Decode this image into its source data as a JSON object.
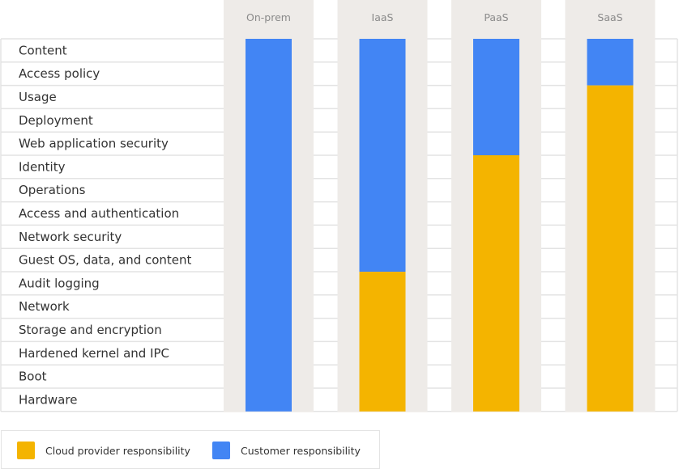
{
  "chart_data": {
    "type": "table",
    "title": "",
    "subtitle": "",
    "description": "Shared responsibility matrix: each column is a stacked bar over 16 ordered layers (top to bottom); customer layers on top, cloud provider layers below.",
    "rows": [
      "Content",
      "Access policy",
      "Usage",
      "Deployment",
      "Web application security",
      "Identity",
      "Operations",
      "Access and authentication",
      "Network security",
      "Guest OS, data, and content",
      "Audit logging",
      "Network",
      "Storage and encryption",
      "Hardened kernel and IPC",
      "Boot",
      "Hardware"
    ],
    "columns": [
      "On-prem",
      "IaaS",
      "PaaS",
      "SaaS"
    ],
    "series": [
      {
        "name": "Customer responsibility",
        "color": "#4285F4",
        "values": [
          16,
          10,
          5,
          2
        ]
      },
      {
        "name": "Cloud provider responsibility",
        "color": "#F4B400",
        "values": [
          0,
          6,
          11,
          14
        ]
      }
    ],
    "legend": {
      "position": "bottom-left",
      "items": [
        {
          "label": "Cloud provider responsibility",
          "color": "#F4B400"
        },
        {
          "label": "Customer responsibility",
          "color": "#4285F4"
        }
      ]
    },
    "grid": true
  },
  "colors": {
    "customer": "#4285F4",
    "provider": "#F4B400",
    "column_panel": "#EEEBE8",
    "row_line": "#E3E3E3"
  }
}
